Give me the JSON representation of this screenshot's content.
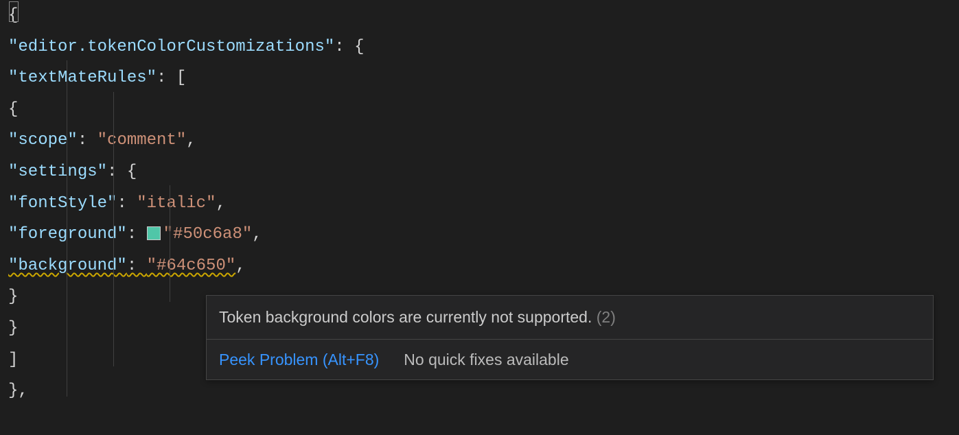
{
  "code": {
    "l1": "{",
    "l2_prop": "\"editor.tokenColorCustomizations\"",
    "l2_punc": ": {",
    "l3_prop": "\"textMateRules\"",
    "l3_punc": ": [",
    "l4": "{",
    "l5_prop": "\"scope\"",
    "l5_mid": ": ",
    "l5_val": "\"comment\"",
    "l5_end": ",",
    "l6_prop": "\"settings\"",
    "l6_punc": ": {",
    "l7_prop": "\"fontStyle\"",
    "l7_mid": ": ",
    "l7_val": "\"italic\"",
    "l7_end": ",",
    "l8_prop": "\"foreground\"",
    "l8_mid": ": ",
    "l8_val": "\"#50c6a8\"",
    "l8_end": ",",
    "l9_prop": "\"background\"",
    "l9_mid": ": ",
    "l9_val": "\"#64c650\"",
    "l9_end": ",",
    "l10": "}",
    "l11": "}",
    "l12": "]",
    "l13": "},"
  },
  "swatch": {
    "foreground": "#50c6a8"
  },
  "hover": {
    "message": "Token background colors are currently not supported.",
    "count": "(2)",
    "peek": "Peek Problem (Alt+F8)",
    "nofix": "No quick fixes available"
  }
}
